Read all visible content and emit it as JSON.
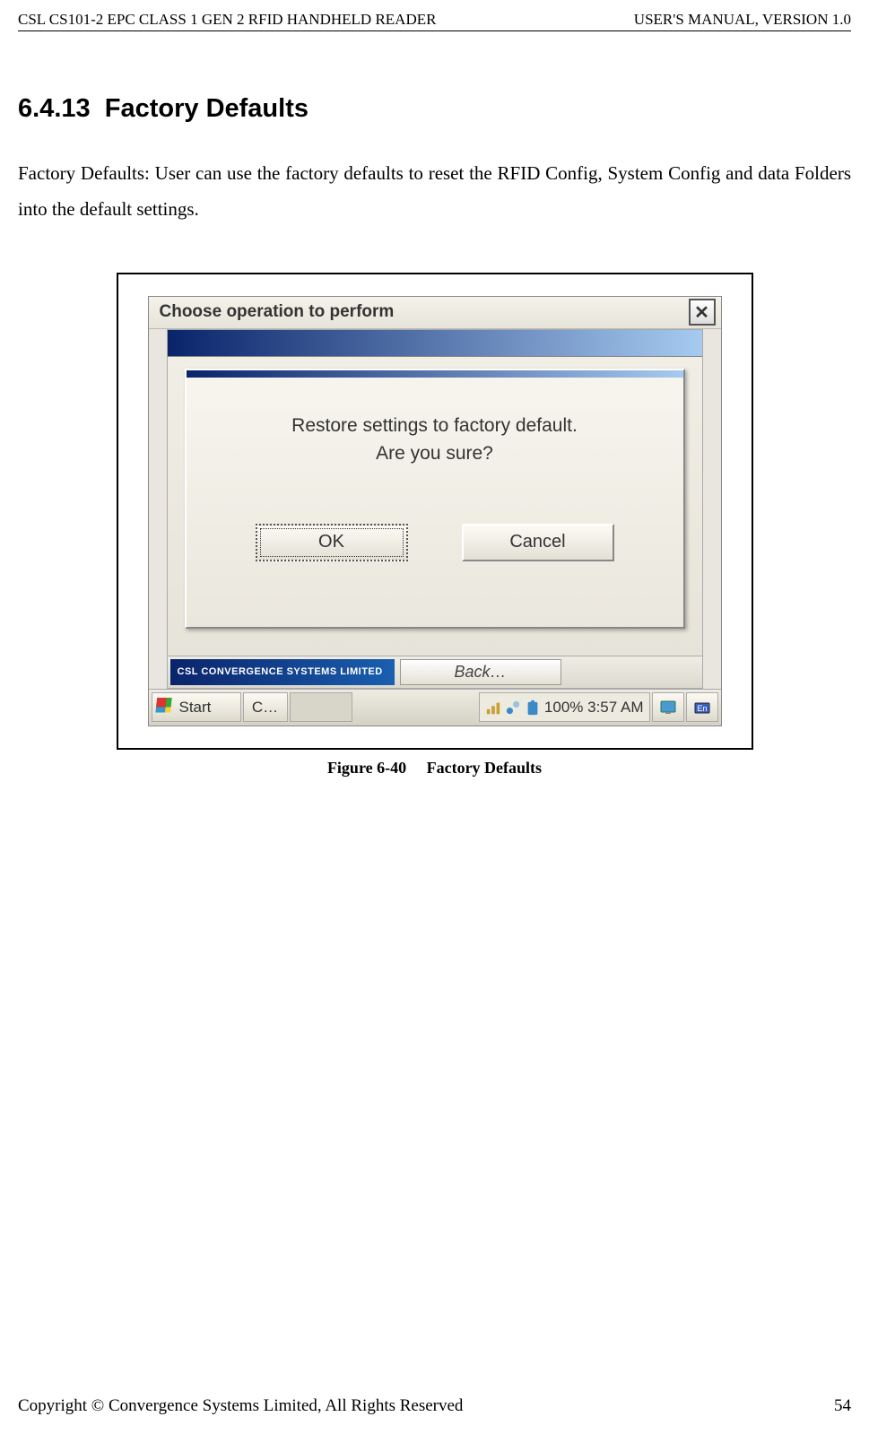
{
  "header": {
    "left": "CSL CS101-2 EPC CLASS 1 GEN 2 RFID HANDHELD READER",
    "right": "USER'S  MANUAL,  VERSION  1.0"
  },
  "section": {
    "number": "6.4.13",
    "title": "Factory Defaults",
    "body": "Factory Defaults: User can use the factory defaults to reset the RFID Config, System Config and data Folders into the default settings."
  },
  "screenshot": {
    "titlebar": "Choose operation to perform",
    "dialog_line1": "Restore settings to factory default.",
    "dialog_line2": "Are you sure?",
    "ok": "OK",
    "cancel": "Cancel",
    "csl_logo": "CSL  CONVERGENCE SYSTEMS LIMITED",
    "back_label": "Back…",
    "start": "Start",
    "task_c": "C…",
    "tray_text": "100% 3:57 AM"
  },
  "figure": {
    "number": "Figure 6-40",
    "label": "Factory Defaults"
  },
  "footer": {
    "copyright": "Copyright © Convergence Systems Limited, All Rights Reserved",
    "page": "54"
  }
}
